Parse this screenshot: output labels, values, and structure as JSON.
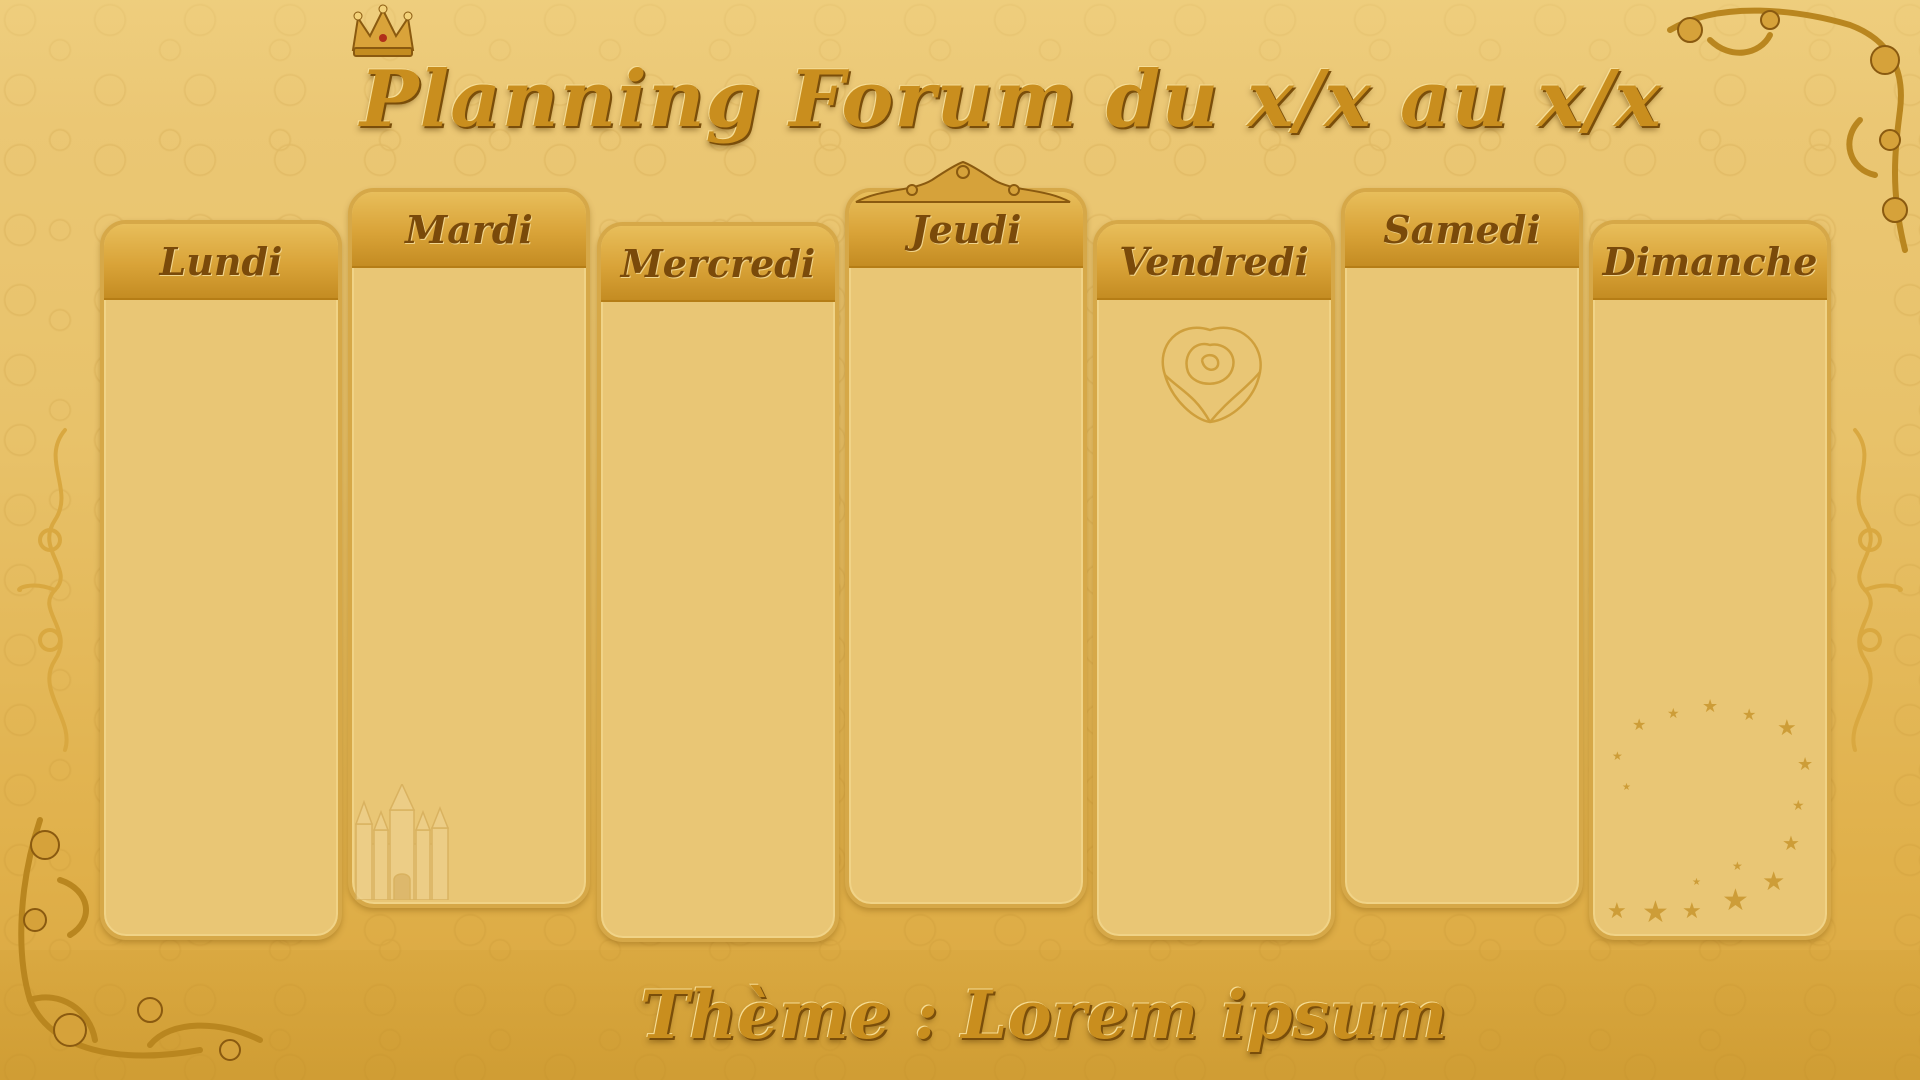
{
  "header": {
    "title": "Planning Forum du x/x au x/x"
  },
  "days": [
    {
      "label": "Lundi"
    },
    {
      "label": "Mardi"
    },
    {
      "label": "Mercredi"
    },
    {
      "label": "Jeudi"
    },
    {
      "label": "Vendredi"
    },
    {
      "label": "Samedi"
    },
    {
      "label": "Dimanche"
    }
  ],
  "footer": {
    "theme": "Thème : Lorem ipsum"
  },
  "decorations": [
    "crown-icon",
    "corner-flourish",
    "side-scroll-ornament",
    "rose-icon",
    "castle-icon",
    "stars-swirl"
  ],
  "colors": {
    "gold": "#c98e1e",
    "dark_gold": "#7a4a0a",
    "column_fill": "#e9c675"
  }
}
